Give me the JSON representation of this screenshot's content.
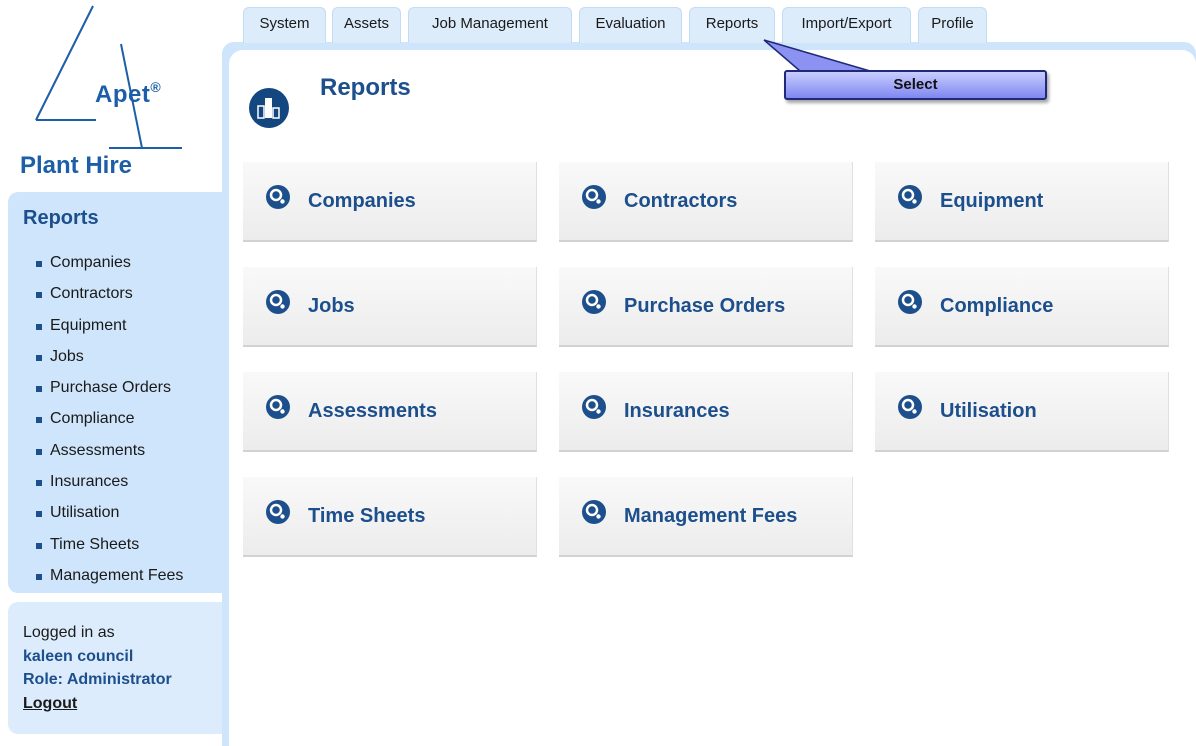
{
  "brand": {
    "logo_name": "Apet",
    "logo_mark": "®",
    "tagline": "Plant Hire",
    "primary_color": "#1c4f8c",
    "logo_color": "#1c5fa8"
  },
  "top_tabs": [
    {
      "label": "System"
    },
    {
      "label": "Assets"
    },
    {
      "label": "Job Management"
    },
    {
      "label": "Evaluation"
    },
    {
      "label": "Reports"
    },
    {
      "label": "Import/Export"
    },
    {
      "label": "Profile"
    }
  ],
  "tooltip": {
    "label": "Select"
  },
  "sidebar": {
    "title": "Reports",
    "items": [
      {
        "label": "Companies"
      },
      {
        "label": "Contractors"
      },
      {
        "label": "Equipment"
      },
      {
        "label": "Jobs"
      },
      {
        "label": "Purchase Orders"
      },
      {
        "label": "Compliance"
      },
      {
        "label": "Assessments"
      },
      {
        "label": "Insurances"
      },
      {
        "label": "Utilisation"
      },
      {
        "label": "Time Sheets"
      },
      {
        "label": "Management Fees"
      }
    ]
  },
  "login": {
    "prefix": "Logged in as",
    "user": "kaleen council",
    "role": "Role: Administrator",
    "logout": "Logout"
  },
  "main": {
    "title": "Reports",
    "title_icon": "bar-chart-icon",
    "tiles": [
      {
        "label": "Companies",
        "icon": "report-gear-icon"
      },
      {
        "label": "Contractors",
        "icon": "report-gear-icon"
      },
      {
        "label": "Equipment",
        "icon": "report-gear-icon"
      },
      {
        "label": "Jobs",
        "icon": "report-gear-icon"
      },
      {
        "label": "Purchase Orders",
        "icon": "report-gear-icon"
      },
      {
        "label": "Compliance",
        "icon": "report-gear-icon"
      },
      {
        "label": "Assessments",
        "icon": "report-gear-icon"
      },
      {
        "label": "Insurances",
        "icon": "report-gear-icon"
      },
      {
        "label": "Utilisation",
        "icon": "report-gear-icon"
      },
      {
        "label": "Time Sheets",
        "icon": "report-gear-icon"
      },
      {
        "label": "Management Fees",
        "icon": "report-gear-icon"
      }
    ]
  }
}
